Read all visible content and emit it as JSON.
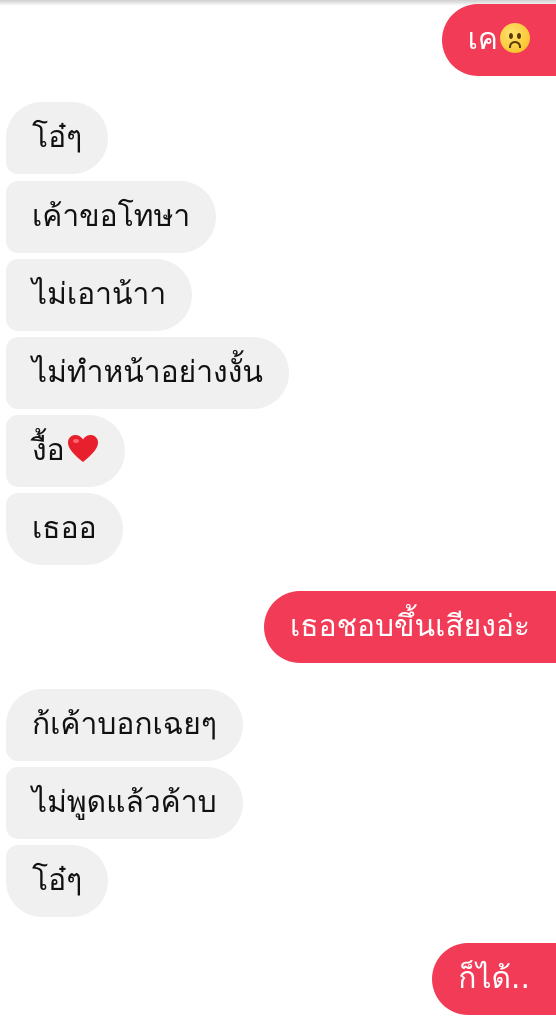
{
  "messages": [
    {
      "id": "m1",
      "side": "outgoing",
      "text": "เค",
      "emoji": "frowning-face-emoji"
    },
    {
      "id": "m2",
      "side": "incoming",
      "text": "โอ๋ๆ"
    },
    {
      "id": "m3",
      "side": "incoming",
      "text": "เค้าขอโทษา"
    },
    {
      "id": "m4",
      "side": "incoming",
      "text": "ไม่เอาน้าา"
    },
    {
      "id": "m5",
      "side": "incoming",
      "text": "ไม่ทำหน้าอย่างงั้น"
    },
    {
      "id": "m6",
      "side": "incoming",
      "text": "งื้อ",
      "emoji": "red-heart-emoji"
    },
    {
      "id": "m7",
      "side": "incoming",
      "text": "เธออ"
    },
    {
      "id": "m8",
      "side": "outgoing",
      "text": "เธอชอบขึ้นเสียงอ่ะ"
    },
    {
      "id": "m9",
      "side": "incoming",
      "text": "ก้เค้าบอกเฉยๆ"
    },
    {
      "id": "m10",
      "side": "incoming",
      "text": "ไม่พูดแล้วค้าบ"
    },
    {
      "id": "m11",
      "side": "incoming",
      "text": "โอ๋ๆ"
    },
    {
      "id": "m12",
      "side": "outgoing",
      "text": "ก็ได้.."
    }
  ],
  "colors": {
    "outgoing_bubble": "#f23c57",
    "incoming_bubble": "#f0f0f0",
    "outgoing_text": "#ffffff",
    "incoming_text": "#111111",
    "heart": "#e8202e"
  }
}
